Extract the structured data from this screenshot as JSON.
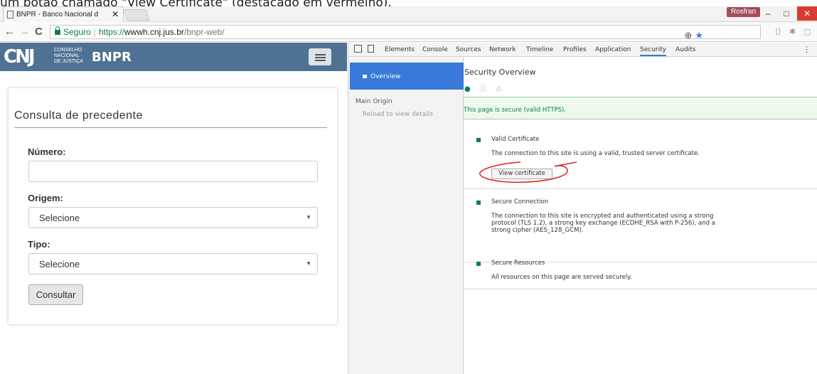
{
  "caption": "um botão chamado \"View Certificate\" (destacado em vermelho).",
  "browser": {
    "tab_title": "BNPR - Banco Nacional d",
    "tab_close": "✕",
    "user_badge": "Rosfran",
    "win_min": "–",
    "win_max": "□",
    "win_close": "✕",
    "back": "←",
    "forward": "→",
    "reload": "C",
    "secure_label": "Seguro",
    "url_scheme": "https://",
    "url_host": "wwwh.cnj.jus.br",
    "url_path": "/bnpr-web/",
    "zoom_icon": "⊕",
    "star_icon": "★"
  },
  "site": {
    "logo_letters": "CNJ",
    "logo_line1": "CONSELHO",
    "logo_line2": "NACIONAL",
    "logo_line3": "DE JUSTIÇA",
    "brand": "BNPR"
  },
  "form": {
    "title": "Consulta de precedente",
    "numero_label": "Número:",
    "numero_value": "",
    "origem_label": "Origem:",
    "origem_value": "Selecione",
    "tipo_label": "Tipo:",
    "tipo_value": "Selecione",
    "submit": "Consultar"
  },
  "devtools": {
    "tabs": [
      "Elements",
      "Console",
      "Sources",
      "Network",
      "Timeline",
      "Profiles",
      "Application",
      "Security",
      "Audits"
    ],
    "active_tab": "Security",
    "sidebar": {
      "overview": "Overview",
      "main_origin": "Main Origin",
      "reload": "Reload to view details"
    },
    "main": {
      "title": "Security Overview",
      "secure_message": "This page is secure (valid HTTPS).",
      "sections": [
        {
          "title": "Valid Certificate",
          "description": "The connection to this site is using a valid, trusted server certificate.",
          "button": "View certificate"
        },
        {
          "title": "Secure Connection",
          "description": "The connection to this site is encrypted and authenticated using a strong protocol (TLS 1.2), a strong key exchange (ECDHE_RSA with P-256), and a strong cipher (AES_128_GCM)."
        },
        {
          "title": "Secure Resources",
          "description": "All resources on this page are served securely."
        }
      ]
    }
  },
  "colors": {
    "header": "#4f7294",
    "devtools_active": "#3879d9",
    "secure_green": "#0b8043",
    "highlight_red": "#e02020"
  }
}
